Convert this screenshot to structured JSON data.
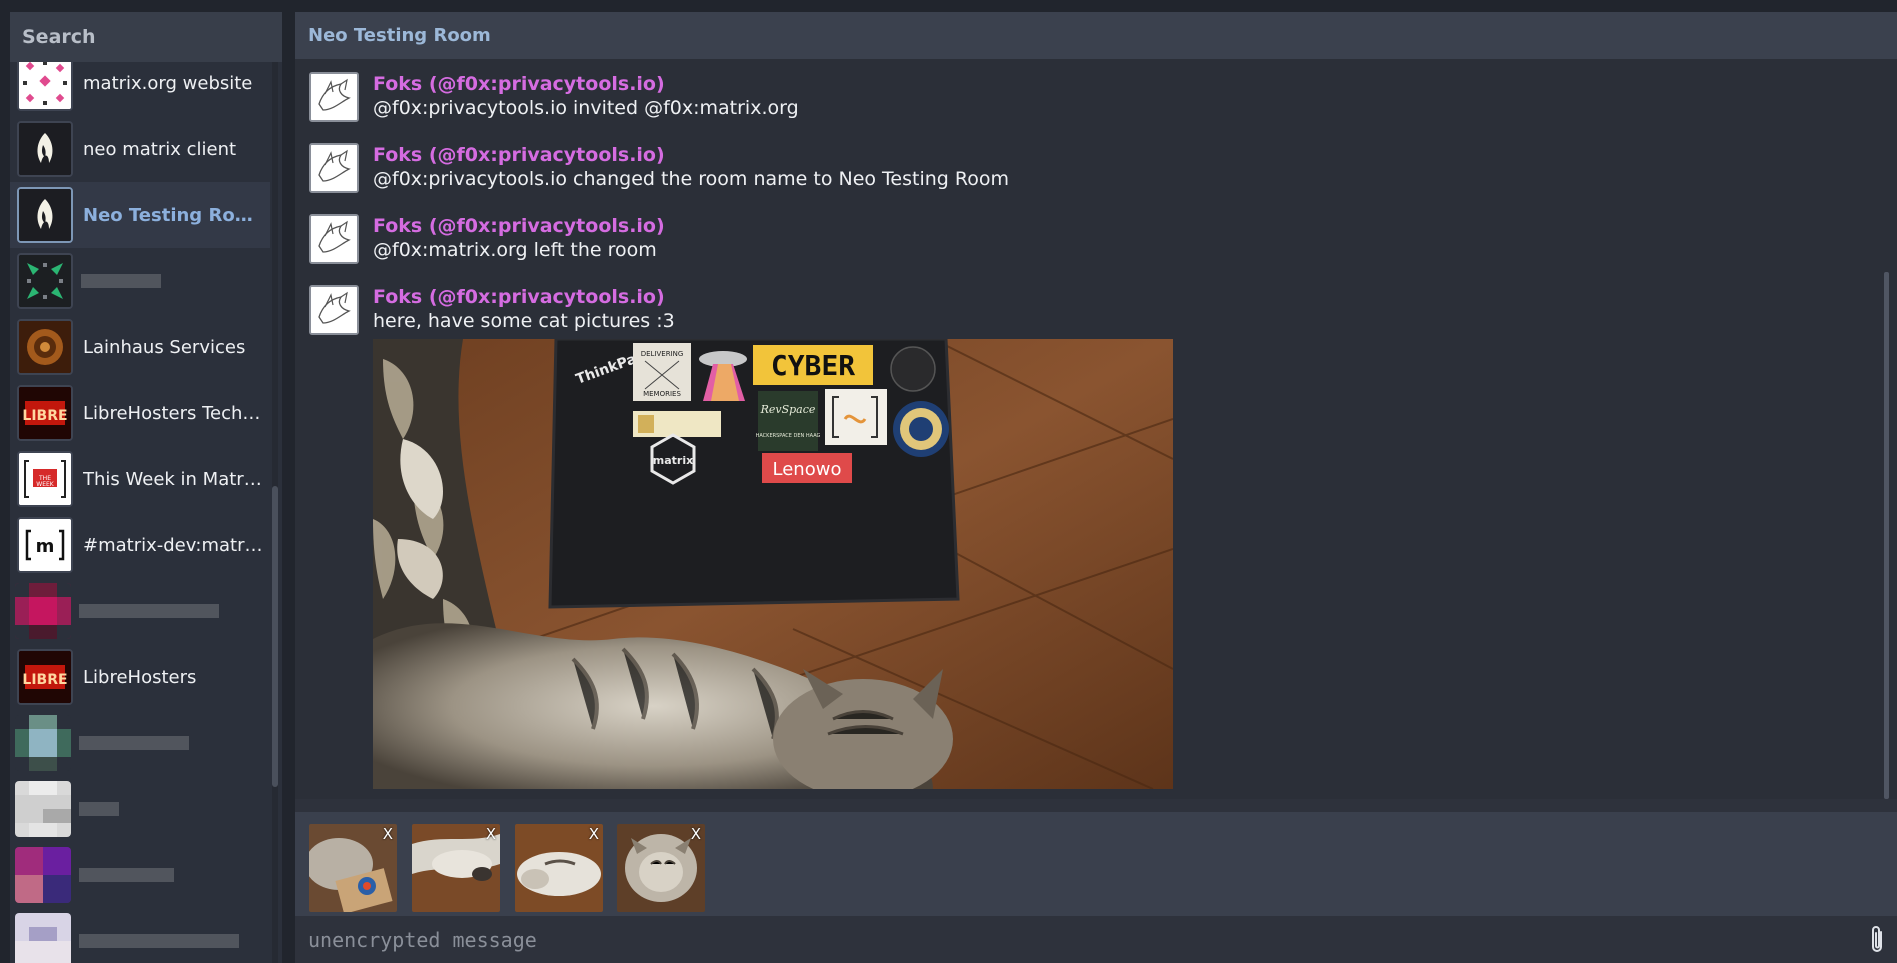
{
  "sidebar": {
    "search_label": "Search",
    "rooms": [
      {
        "label": "matrix.org website"
      },
      {
        "label": "neo matrix client"
      },
      {
        "label": "Neo Testing Room",
        "active": true
      },
      {
        "label": ""
      },
      {
        "label": "Lainhaus Services"
      },
      {
        "label": "LibreHosters Techt..."
      },
      {
        "label": "This Week in Matrix..."
      },
      {
        "label": "#matrix-dev:matrix...."
      },
      {
        "label": ""
      },
      {
        "label": "LibreHosters"
      },
      {
        "label": ""
      },
      {
        "label": ""
      },
      {
        "label": ""
      },
      {
        "label": ""
      }
    ]
  },
  "header": {
    "room_name": "Neo Testing Room"
  },
  "messages": [
    {
      "sender": "Foks (@f0x:privacytools.io)",
      "text": "@f0x:privacytools.io invited @f0x:matrix.org"
    },
    {
      "sender": "Foks (@f0x:privacytools.io)",
      "text": "@f0x:privacytools.io changed the room name to Neo Testing Room"
    },
    {
      "sender": "Foks (@f0x:privacytools.io)",
      "text": "@f0x:matrix.org left the room"
    },
    {
      "sender": "Foks (@f0x:privacytools.io)",
      "text": "here, have some cat pictures :3"
    }
  ],
  "photo": {
    "stickers": {
      "thinkpad": "ThinkPad",
      "cyber": "CYBER",
      "matrix": "matrix",
      "lenowo": "Lenowo",
      "delivering": "DELIVERING",
      "memories": "MEMORIES",
      "revspace": "RevSpace",
      "hackerspace": "HACKERSPACE DEN HAAG"
    }
  },
  "attachments": [
    {
      "remove_label": "X"
    },
    {
      "remove_label": "X"
    },
    {
      "remove_label": "X"
    },
    {
      "remove_label": "X"
    }
  ],
  "composer": {
    "placeholder": "unencrypted message"
  },
  "colors": {
    "sender": "#d56ce1",
    "active_room": "#8cb0dd",
    "header_text": "#9cb8d8"
  }
}
